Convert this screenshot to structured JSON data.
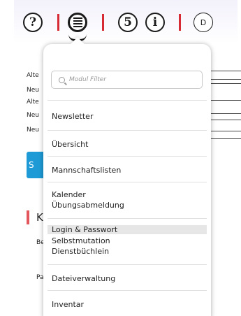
{
  "toolbar": {
    "help_glyph": "?",
    "back_glyph": "5",
    "info_glyph": "i",
    "d_glyph": "D"
  },
  "background": {
    "rows": [
      "Alte",
      "Neu",
      "Alte",
      "Neu",
      "Neu"
    ],
    "button_fragment": "S",
    "heading_fragment": "K",
    "label1_fragment": "Be",
    "label2_fragment": "Pa"
  },
  "dropdown": {
    "filter_placeholder": "Modul Filter",
    "items": [
      "Newsletter",
      "Übersicht",
      "Mannschaftslisten",
      "Kalender",
      "Übungsabmeldung",
      "Login & Passwort",
      "Selbstmutation",
      "Dienstbüchlein",
      "Dateiverwaltung",
      "Inventar"
    ]
  },
  "colors": {
    "accent_red": "#d62b35",
    "button_blue": "#1e9bd6",
    "highlight_gray": "#e6e6e6"
  },
  "icons": [
    "help-icon",
    "menu-list-icon",
    "back-icon",
    "info-icon",
    "d-icon"
  ]
}
